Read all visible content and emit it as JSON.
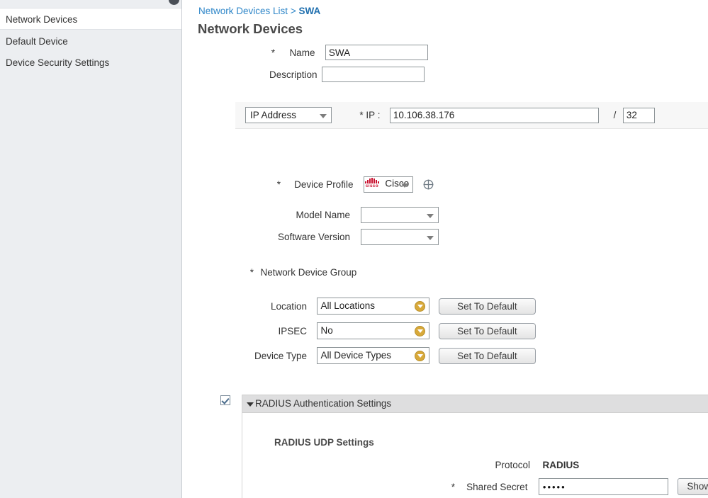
{
  "sidebar": {
    "items": [
      {
        "label": "Network Devices",
        "selected": true
      },
      {
        "label": "Default Device",
        "selected": false
      },
      {
        "label": "Device Security Settings",
        "selected": false
      }
    ]
  },
  "breadcrumb": {
    "parent": "Network Devices List",
    "separator": ">",
    "current": "SWA"
  },
  "page": {
    "title": "Network Devices"
  },
  "form": {
    "name_label": "Name",
    "name_required": "*",
    "name_value": "SWA",
    "description_label": "Description",
    "description_value": "",
    "ip_type_value": "IP Address",
    "ip_label": "* IP :",
    "ip_value": "10.106.38.176",
    "mask_separator": "/",
    "mask_value": "32",
    "device_profile_required": "*",
    "device_profile_label": "Device Profile",
    "device_profile_value": "Cisco",
    "device_profile_logo": "cisco-logo",
    "add_profile_icon": "add-target-icon",
    "model_name_label": "Model Name",
    "model_name_value": "",
    "software_version_label": "Software Version",
    "software_version_value": ""
  },
  "device_group": {
    "required": "*",
    "title": "Network Device Group",
    "rows": [
      {
        "label": "Location",
        "value": "All Locations",
        "button": "Set To Default"
      },
      {
        "label": "IPSEC",
        "value": "No",
        "button": "Set To Default"
      },
      {
        "label": "Device Type",
        "value": "All Device Types",
        "button": "Set To Default"
      }
    ]
  },
  "radius": {
    "enabled": true,
    "section_title": "RADIUS Authentication Settings",
    "udp_title": "RADIUS UDP Settings",
    "protocol_label": "Protocol",
    "protocol_value": "RADIUS",
    "shared_secret_required": "*",
    "shared_secret_label": "Shared Secret",
    "shared_secret_value": "•••••",
    "show_button": "Show"
  },
  "colors": {
    "link": "#2e86c8",
    "sidebar_bg": "#eceef1",
    "panel_header": "#dededf",
    "gold_accent": "#d8a93a",
    "cisco_red": "#c8102e"
  }
}
